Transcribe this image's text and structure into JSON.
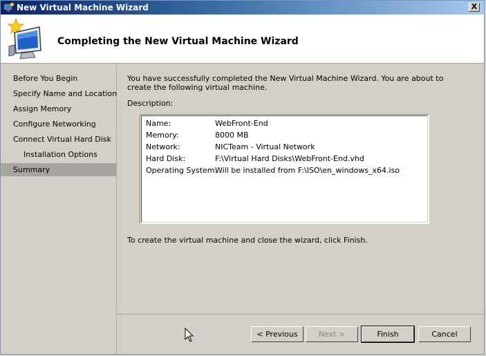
{
  "window": {
    "title": "New Virtual Machine Wizard",
    "close_label": "X"
  },
  "header": {
    "title": "Completing the New Virtual Machine Wizard"
  },
  "nav": {
    "items": [
      {
        "label": "Before You Begin"
      },
      {
        "label": "Specify Name and Location"
      },
      {
        "label": "Assign Memory"
      },
      {
        "label": "Configure Networking"
      },
      {
        "label": "Connect Virtual Hard Disk"
      },
      {
        "label": "Installation Options"
      },
      {
        "label": "Summary",
        "selected": true
      }
    ]
  },
  "content": {
    "intro": "You have successfully completed the New Virtual Machine Wizard. You are about to create the following virtual machine.",
    "description_label": "Description:",
    "rows": [
      {
        "key": "Name:",
        "value": "WebFront-End"
      },
      {
        "key": "Memory:",
        "value": "8000 MB"
      },
      {
        "key": "Network:",
        "value": "NICTeam - Virtual Network"
      },
      {
        "key": "Hard Disk:",
        "value": "F:\\Virtual Hard Disks\\WebFront-End.vhd"
      },
      {
        "key": "Operating System:",
        "value": "Will be installed from F:\\ISO\\en_windows_x64.iso"
      }
    ],
    "finish_note": "To create the virtual machine and close the wizard, click Finish."
  },
  "buttons": {
    "previous": "< Previous",
    "next": "Next >",
    "finish": "Finish",
    "cancel": "Cancel"
  },
  "colors": {
    "titlebar": "#0a246a",
    "selected_nav": "#a8a4a0",
    "background": "#d4d0c8"
  },
  "icons": {
    "title": "vm-wizard-icon",
    "header": "monitor-star-icon",
    "cursor": "mouse-pointer-icon"
  }
}
